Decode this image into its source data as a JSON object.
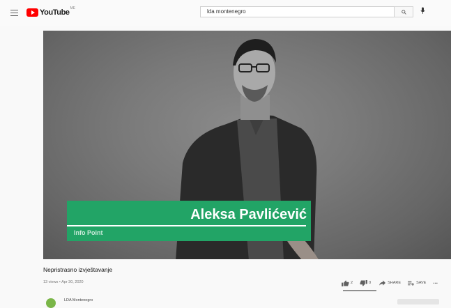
{
  "header": {
    "logo_text": "YouTube",
    "logo_region": "ME",
    "search_value": "lda montenegro",
    "icons": {
      "menu": "hamburger-menu-icon",
      "search": "search-icon",
      "mic": "microphone-icon"
    }
  },
  "video": {
    "overlay_name": "Aleksa Pavlićević",
    "overlay_subtitle": "Info Point",
    "title": "Nepristrasno izvještavanje",
    "meta": "13 views • Apr 30, 2020"
  },
  "actions": {
    "like_count": "2",
    "dislike_count": "0",
    "share_label": "SHARE",
    "save_label": "SAVE",
    "more_label": "...",
    "like_ratio": 1.0
  },
  "channel": {
    "name": "LDA Montenegro",
    "subscribe_label": ""
  },
  "colors": {
    "brand_red": "#ff0000",
    "lower_third_green": "#22a466"
  }
}
